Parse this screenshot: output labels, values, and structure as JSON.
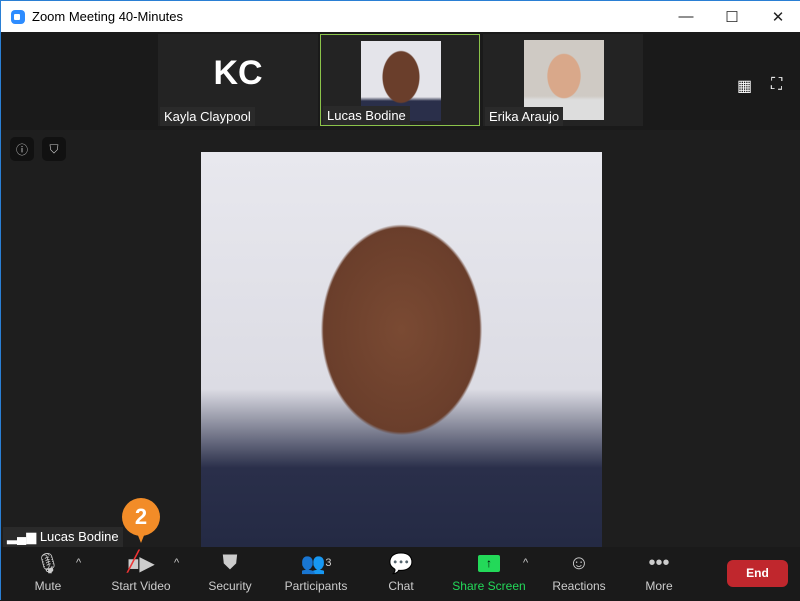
{
  "window": {
    "title": "Zoom Meeting 40-Minutes",
    "minimize": "—",
    "maximize": "☐",
    "close": "✕"
  },
  "gallery": {
    "tiles": [
      {
        "name": "Kayla Claypool",
        "initials": "KC"
      },
      {
        "name": "Lucas Bodine"
      },
      {
        "name": "Erika Araujo"
      }
    ]
  },
  "main": {
    "speaker": "Lucas Bodine",
    "step_badge": "2"
  },
  "toolbar": {
    "mute": "Mute",
    "start_video": "Start Video",
    "security": "Security",
    "participants": "Participants",
    "participant_count": "3",
    "chat": "Chat",
    "share_screen": "Share Screen",
    "reactions": "Reactions",
    "more": "More",
    "end": "End"
  },
  "colors": {
    "accent": "#2d8cff",
    "share": "#23d959",
    "end": "#c0272d",
    "badge": "#f28c28"
  }
}
